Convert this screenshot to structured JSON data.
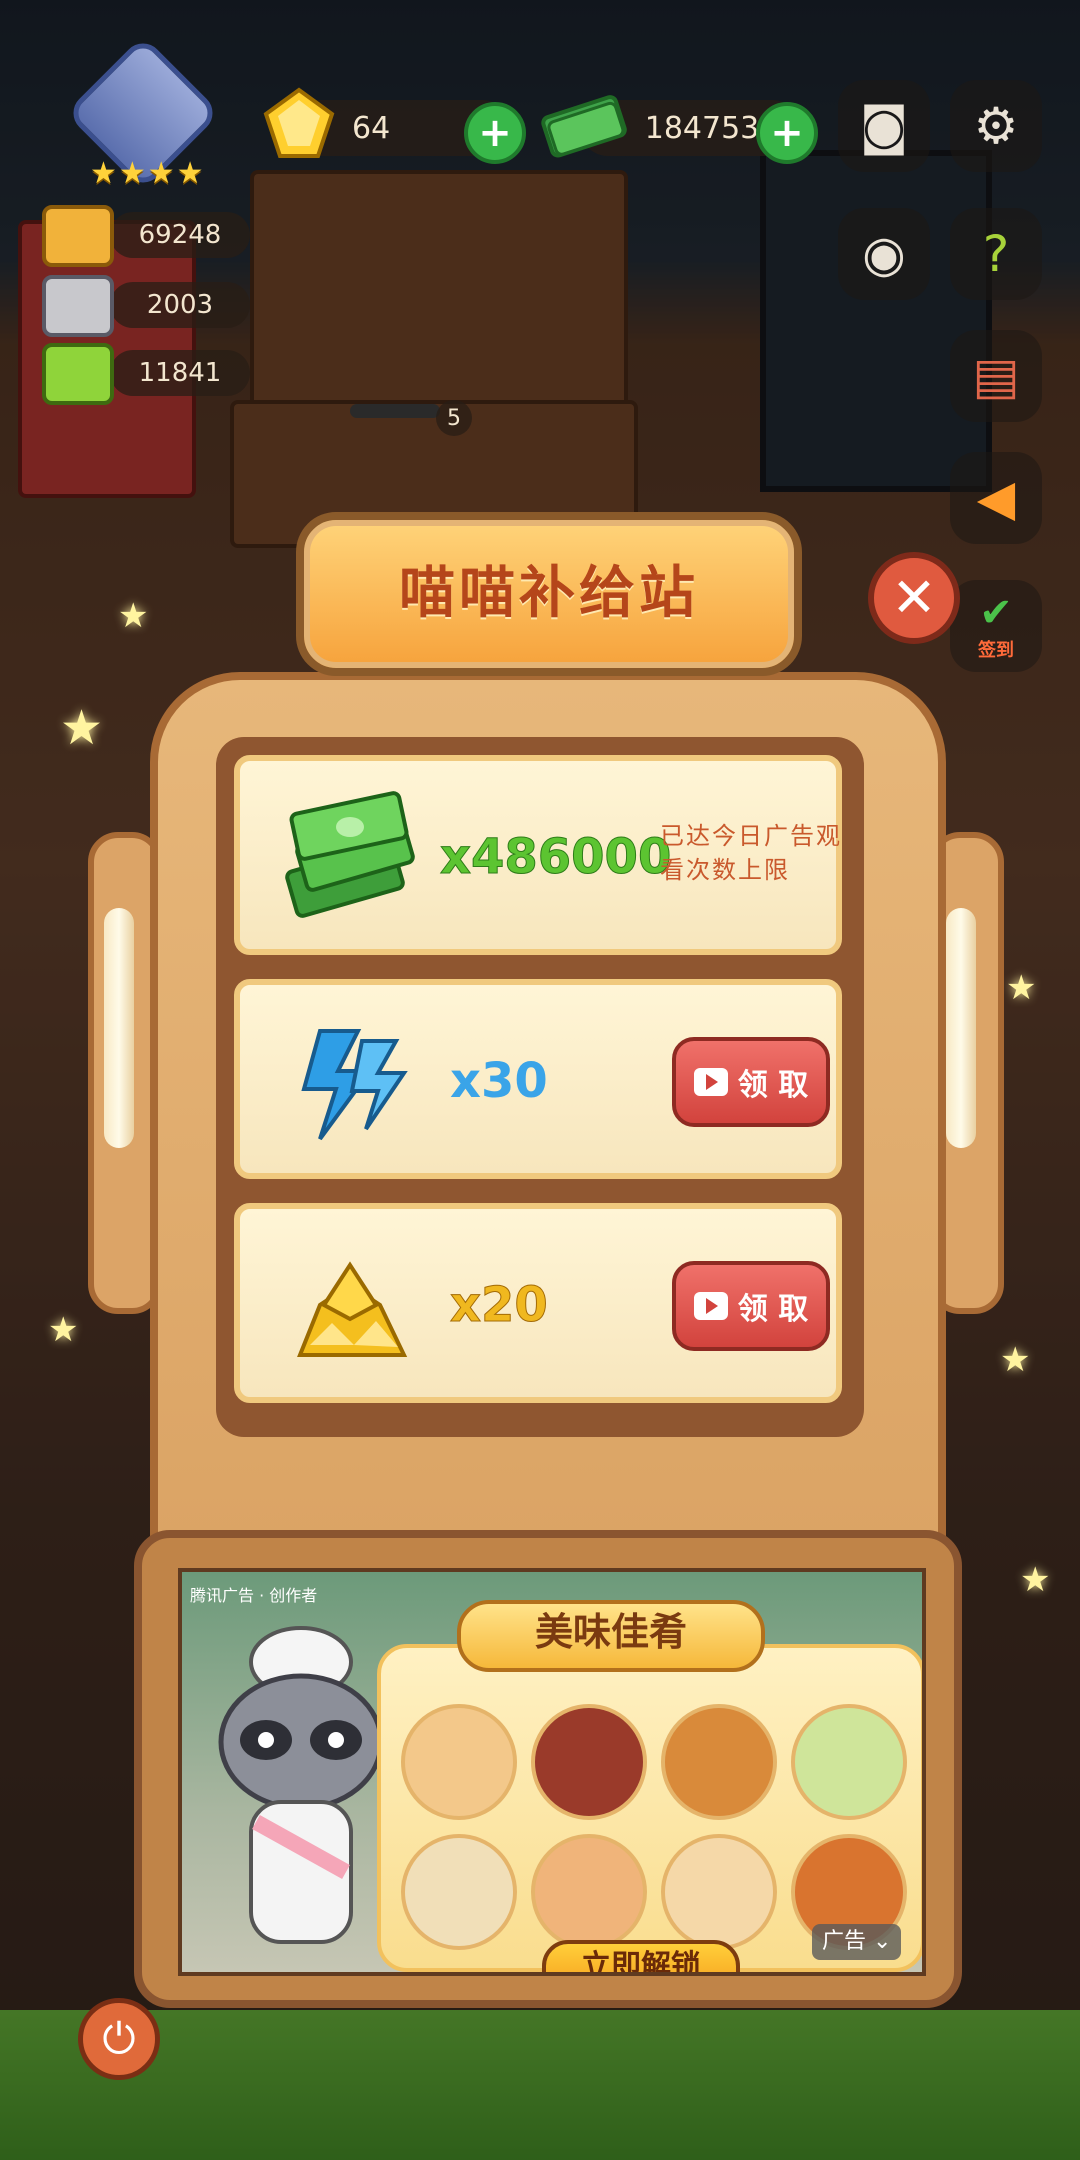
{
  "hud": {
    "gems": "64",
    "cash": "184753",
    "stat_top": "69248",
    "stat_mid": "2003",
    "stat_bottom": "11841",
    "bar_count": "5",
    "checkin_label": "签到"
  },
  "panel": {
    "title": "喵喵补给站",
    "rewards": [
      {
        "quantity": "x486000",
        "status": "已达今日广告观看次数上限"
      },
      {
        "quantity": "x30",
        "button": "领 取"
      },
      {
        "quantity": "x20",
        "button": "领 取"
      }
    ]
  },
  "ad": {
    "banner": "美味佳肴",
    "button": "立即解锁",
    "label": "广告",
    "tags": "腾讯广告 · 创作者"
  },
  "colors": {
    "accent_red": "#d2433d",
    "cash_green": "#5cc431",
    "bolt_blue": "#3aa4e8",
    "gold": "#f0b81f"
  }
}
